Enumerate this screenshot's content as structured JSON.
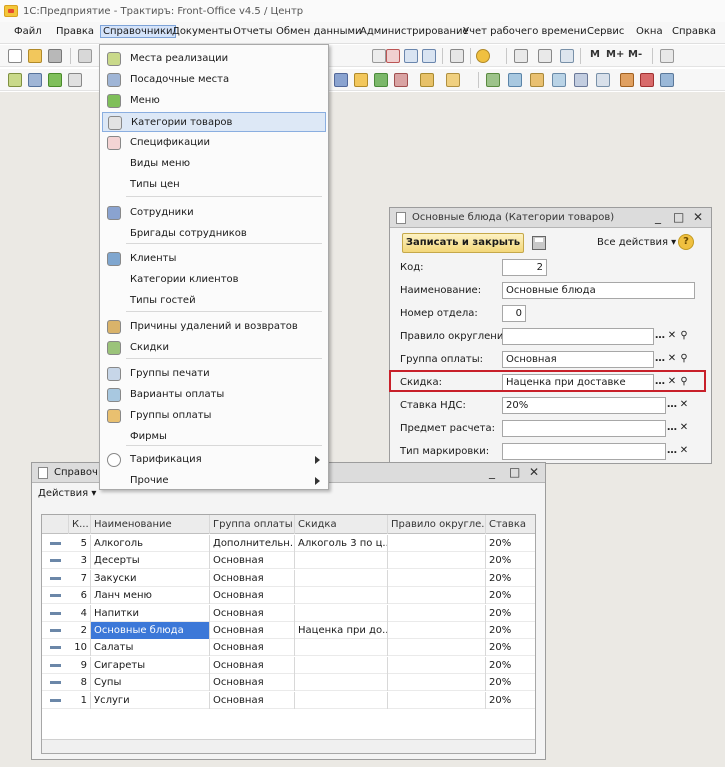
{
  "app": {
    "title": "1С:Предприятие - Трактиръ: Front-Office v4.5 / Центр"
  },
  "menubar": {
    "items": [
      "Файл",
      "Правка",
      "Справочники",
      "Документы",
      "Отчеты",
      "Обмен данными",
      "Администрирование",
      "Учет рабочего времени",
      "Сервис",
      "Окна",
      "Справка"
    ]
  },
  "toolbar": {
    "m": "M",
    "mplus": "M+",
    "mminus": "M-"
  },
  "dropdown": {
    "items": [
      {
        "label": "Места реализации",
        "icon": "places-icon"
      },
      {
        "label": "Посадочные места",
        "icon": "seats-icon"
      },
      {
        "label": "Меню",
        "icon": "menu-leaf-icon"
      },
      {
        "label": "Категории товаров",
        "icon": "fork-knife-icon"
      },
      {
        "label": "Спецификации",
        "icon": "check-icon"
      },
      {
        "label": "Виды меню",
        "icon": ""
      },
      {
        "label": "Типы цен",
        "icon": ""
      },
      {
        "label": "Сотрудники",
        "icon": "employees-icon"
      },
      {
        "label": "Бригады сотрудников",
        "icon": ""
      },
      {
        "label": "Клиенты",
        "icon": "clients-icon"
      },
      {
        "label": "Категории клиентов",
        "icon": ""
      },
      {
        "label": "Типы гостей",
        "icon": ""
      },
      {
        "label": "Причины удалений и возвратов",
        "icon": "delete-reasons-icon"
      },
      {
        "label": "Скидки",
        "icon": "discounts-icon"
      },
      {
        "label": "Группы печати",
        "icon": "printer-icon"
      },
      {
        "label": "Варианты оплаты",
        "icon": "payment-variants-icon"
      },
      {
        "label": "Группы оплаты",
        "icon": "payment-groups-icon"
      },
      {
        "label": "Фирмы",
        "icon": ""
      },
      {
        "label": "Тарификация",
        "icon": "clock-icon"
      },
      {
        "label": "Прочие",
        "icon": ""
      }
    ]
  },
  "form": {
    "title": "Основные блюда (Категории товаров)",
    "save_label": "Записать и закрыть",
    "all_actions": "Все действия",
    "help": "?",
    "fields": [
      {
        "label": "Код:",
        "value": "2"
      },
      {
        "label": "Наименование:",
        "value": "Основные блюда"
      },
      {
        "label": "Номер отдела:",
        "value": "0"
      },
      {
        "label": "Правило округления:",
        "value": ""
      },
      {
        "label": "Группа оплаты:",
        "value": "Основная"
      },
      {
        "label": "Скидка:",
        "value": "Наценка при доставке"
      },
      {
        "label": "Ставка НДС:",
        "value": "20%"
      },
      {
        "label": "Предмет расчета:",
        "value": ""
      },
      {
        "label": "Тип маркировки:",
        "value": ""
      }
    ]
  },
  "list": {
    "title": "Справоч",
    "actions": "Действия",
    "columns": [
      "К...",
      "Наименование",
      "Группа оплаты",
      "Скидка",
      "Правило округле...",
      "Ставка"
    ],
    "rows": [
      {
        "code": "5",
        "name": "Алкоголь",
        "group": "Дополнительн...",
        "discount": "Алкоголь 3 по ц...",
        "rounding": "",
        "vat": "20%"
      },
      {
        "code": "3",
        "name": "Десерты",
        "group": "Основная",
        "discount": "",
        "rounding": "",
        "vat": "20%"
      },
      {
        "code": "7",
        "name": "Закуски",
        "group": "Основная",
        "discount": "",
        "rounding": "",
        "vat": "20%"
      },
      {
        "code": "6",
        "name": "Ланч меню",
        "group": "Основная",
        "discount": "",
        "rounding": "",
        "vat": "20%"
      },
      {
        "code": "4",
        "name": "Напитки",
        "group": "Основная",
        "discount": "",
        "rounding": "",
        "vat": "20%"
      },
      {
        "code": "2",
        "name": "Основные блюда",
        "group": "Основная",
        "discount": "Наценка при до...",
        "rounding": "",
        "vat": "20%"
      },
      {
        "code": "10",
        "name": "Салаты",
        "group": "Основная",
        "discount": "",
        "rounding": "",
        "vat": "20%"
      },
      {
        "code": "9",
        "name": "Сигареты",
        "group": "Основная",
        "discount": "",
        "rounding": "",
        "vat": "20%"
      },
      {
        "code": "8",
        "name": "Супы",
        "group": "Основная",
        "discount": "",
        "rounding": "",
        "vat": "20%"
      },
      {
        "code": "1",
        "name": "Услуги",
        "group": "Основная",
        "discount": "",
        "rounding": "",
        "vat": "20%"
      }
    ]
  }
}
